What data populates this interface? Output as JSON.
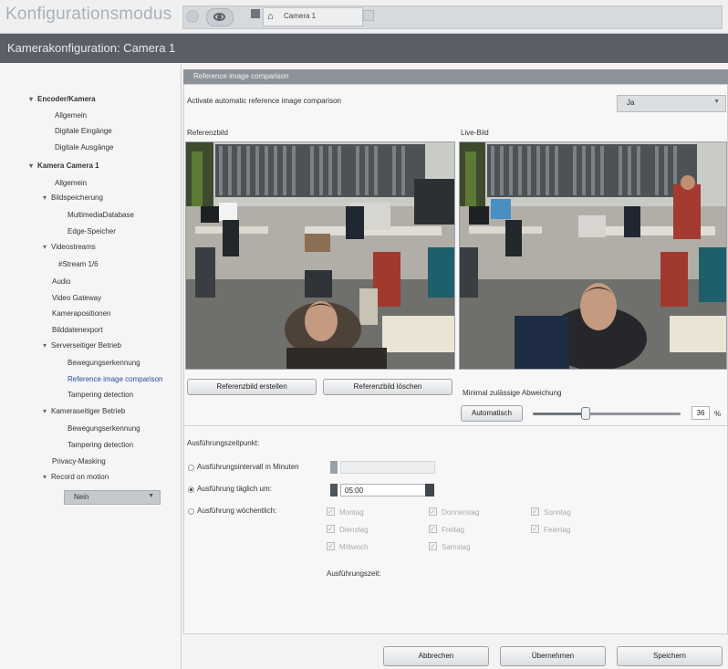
{
  "app": {
    "title": "Konfigurationsmodus",
    "camera_tab": "Camera 1"
  },
  "header": {
    "title": "Kamerakonfiguration: Camera 1"
  },
  "nav": {
    "items": [
      {
        "label": "Encoder/Kamera",
        "twisty": "▾"
      },
      {
        "label": "Allgemein"
      },
      {
        "label": "Digitale Eingänge"
      },
      {
        "label": "Digitale Ausgänge"
      },
      {
        "label": "Kamera Camera 1",
        "twisty": "▾"
      },
      {
        "label": "Allgemein"
      },
      {
        "label": "Bildspeicherung",
        "twisty": "▾"
      },
      {
        "label": "MultimediaDatabase"
      },
      {
        "label": "Edge-Speicher"
      },
      {
        "label": "Videostreams",
        "twisty": "▾"
      },
      {
        "label": "#Stream 1/6"
      },
      {
        "label": "Audio"
      },
      {
        "label": "Video Gateway"
      },
      {
        "label": "Kamerapositionen"
      },
      {
        "label": "Bilddatenexport"
      },
      {
        "label": "Serverseitiger Betrieb",
        "twisty": "▾"
      },
      {
        "label": "Bewegungserkennung"
      },
      {
        "label": "Reference image comparison"
      },
      {
        "label": "Tampering detection"
      },
      {
        "label": "Kameraseitiger Betrieb",
        "twisty": "▾"
      },
      {
        "label": "Bewegungserkennung"
      },
      {
        "label": "Tampering detection"
      },
      {
        "label": "Privacy-Masking"
      },
      {
        "label": "Record on motion",
        "twisty": "▾"
      }
    ],
    "record_value": "Nein"
  },
  "section": {
    "title": "Reference image comparison",
    "activate_label": "Activate automatic reference image comparison",
    "activate_value": "Ja",
    "ref_label": "Referenzbild",
    "live_label": "Live-Bild",
    "btn_create": "Referenzbild erstellen",
    "btn_delete": "Referenzbild löschen",
    "deviation_label": "Minimal zulässige Abweichung",
    "btn_auto": "Automatisch",
    "deviation_value": 36,
    "deviation_display": "36",
    "deviation_unit": "%",
    "schedule_title": "Ausführungszeitpunkt:",
    "opt_interval": "Ausführungsintervall in Minuten",
    "opt_daily": "Ausführung täglich um:",
    "daily_time": "05:00",
    "opt_weekly": "Ausführung wöchentlich:",
    "days": [
      "Montag",
      "Donnerstag",
      "Sonntag",
      "Dienstag",
      "Freitag",
      "Feiertag",
      "Mittwoch",
      "Samstag"
    ],
    "exec_time_label": "Ausführungszeit:"
  },
  "footer": {
    "cancel": "Abbrechen",
    "apply": "Übernehmen",
    "save": "Speichern"
  },
  "colors": {
    "header_bg": "#5a5f66",
    "section_bg": "#8d9298",
    "selected_nav": "#2a4f9c"
  }
}
